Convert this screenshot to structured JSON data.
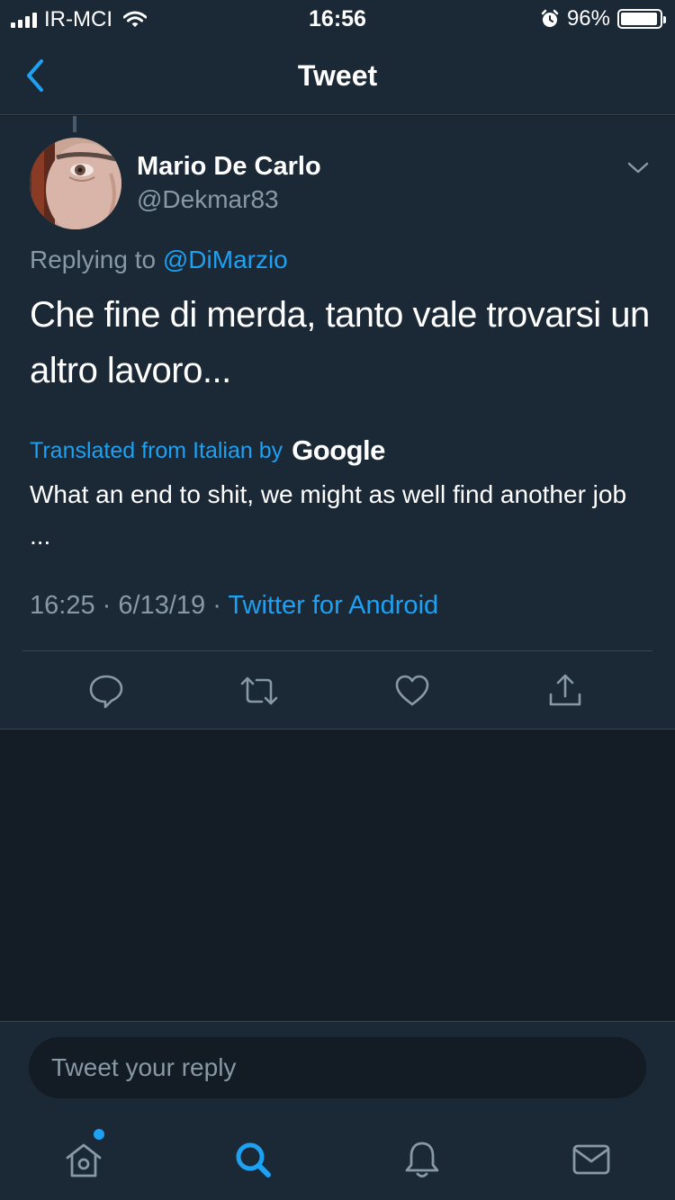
{
  "status_bar": {
    "carrier": "IR-MCI",
    "time": "16:56",
    "battery": "96%",
    "battery_level": 0.96
  },
  "header": {
    "title": "Tweet"
  },
  "tweet": {
    "display_name": "Mario De Carlo",
    "handle": "@Dekmar83",
    "replying_prefix": "Replying to",
    "replying_to": "@DiMarzio",
    "text": "Che fine di merda, tanto vale trovarsi un altro lavoro...",
    "translated_label": "Translated from Italian by",
    "translator": "Google",
    "translation": "What an end to shit, we might as well find another job ...",
    "time": "16:25",
    "date": "6/13/19",
    "separator": "·",
    "source": "Twitter for Android"
  },
  "actions": [
    "reply-icon",
    "retweet-icon",
    "like-icon",
    "share-icon"
  ],
  "reply_box": {
    "placeholder": "Tweet your reply"
  },
  "tab_bar": {
    "tabs": [
      "home-icon",
      "search-icon",
      "notifications-icon",
      "messages-icon"
    ],
    "active": "search-icon",
    "home_has_new": true
  },
  "colors": {
    "accent": "#1da1f2",
    "background": "#1b2836",
    "page_background": "#141d26",
    "muted": "#8899a6"
  }
}
